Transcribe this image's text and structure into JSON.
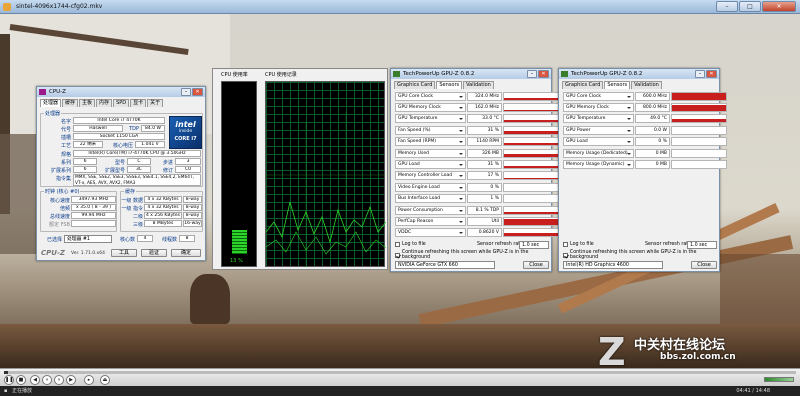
{
  "player": {
    "title": "sintel-4096x1744-cfg02.mkv",
    "status_text": "正在播放",
    "time": "04:41 / 14:48"
  },
  "watermark": {
    "cn": "中关村在线论坛",
    "url": "bbs.zol.com.cn"
  },
  "cpuz": {
    "title": "CPU-Z",
    "tabs": [
      "处理器",
      "缓存",
      "主板",
      "内存",
      "SPD",
      "显卡",
      "关于"
    ],
    "group_processor": "处理器",
    "name_label": "名字",
    "name": "Intel Core i7 4770K",
    "codename_label": "代号",
    "codename": "Haswell",
    "tdp_label": "TDP",
    "tdp": "84.0 W",
    "package_label": "插槽",
    "package": "Socket 1150 LGA",
    "tech_label": "工艺",
    "tech": "22 纳米",
    "voltage_label": "核心电压",
    "voltage": "1.041 V",
    "spec_label": "规格",
    "spec": "Intel(R) Core(TM) i7-4770K CPU @ 3.50GHz",
    "family_label": "系列",
    "family": "6",
    "model_label": "型号",
    "model": "C",
    "stepping_label": "步进",
    "stepping": "3",
    "extfamily_label": "扩展系列",
    "extfamily": "6",
    "extmodel_label": "扩展型号",
    "extmodel": "3C",
    "revision_label": "修订",
    "revision": "C0",
    "instr_label": "指令集",
    "instr": "MMX, SSE, SSE2, SSE3, SSSE3, SSE4.1, SSE4.2, EM64T, VT-x, AES, AVX, AVX2, FMA3",
    "clocks_group": "时钟 (核心 #0)",
    "core_speed_label": "核心速度",
    "core_speed": "3497.93 MHz",
    "multiplier_label": "倍频",
    "multiplier": "x 35.0 ( 8 - 39 )",
    "bus_label": "总线速度",
    "bus": "99.94 MHz",
    "fsb_label": "额定 FSB",
    "fsb": "",
    "cache_group": "缓存",
    "l1d_label": "一级 数据",
    "l1d": "4 x 32 KBytes",
    "l1d_way": "8-way",
    "l1i_label": "一级 指令",
    "l1i": "4 x 32 KBytes",
    "l1i_way": "8-way",
    "l2_label": "二级",
    "l2": "4 x 256 KBytes",
    "l2_way": "8-way",
    "l3_label": "三级",
    "l3": "8 MBytes",
    "l3_way": "16-way",
    "selected_label": "已选择",
    "selected": "处理器 #1",
    "cores_label": "核心数",
    "cores": "4",
    "threads_label": "线程数",
    "threads": "8",
    "version": "Ver. 1.71.0.x64",
    "tools_btn": "工具",
    "validate_btn": "验证",
    "ok_btn": "确定",
    "logo_brand": "intel",
    "logo_line1": "inside",
    "logo_line2": "CORE i7"
  },
  "taskmgr": {
    "cpu_usage_label": "CPU 使用率",
    "cpu_history_label": "CPU 使用记录",
    "usage_percent": "13 %",
    "usage_value": 0.13
  },
  "gpuz1": {
    "title": "TechPowerUp GPU-Z 0.8.2",
    "tabs": [
      "Graphics Card",
      "Sensors",
      "Validation"
    ],
    "sensors": [
      {
        "name": "GPU Core Clock",
        "value": "324.0 MHz",
        "level": 0.25
      },
      {
        "name": "GPU Memory Clock",
        "value": "162.0 MHz",
        "level": 0.15
      },
      {
        "name": "GPU Temperature",
        "value": "33.0 °C",
        "level": 0.35
      },
      {
        "name": "Fan Speed (%)",
        "value": "31 %",
        "level": 0.35
      },
      {
        "name": "Fan Speed (RPM)",
        "value": "1140 RPM",
        "level": 0.35
      },
      {
        "name": "Memory Used",
        "value": "326 MB",
        "level": 0.4
      },
      {
        "name": "GPU Load",
        "value": "31 %",
        "level": 0.3
      },
      {
        "name": "Memory Controller Load",
        "value": "17 %",
        "level": 0.2
      },
      {
        "name": "Video Engine Load",
        "value": "0 %",
        "level": 0.0
      },
      {
        "name": "Bus Interface Load",
        "value": "1 %",
        "level": 0.05
      },
      {
        "name": "Power Consumption",
        "value": "8.1 % TDP",
        "level": 0.2
      },
      {
        "name": "PerfCap Reason",
        "value": "Util",
        "level": 0.9
      },
      {
        "name": "VDDC",
        "value": "0.8620 V",
        "level": 0.45
      }
    ],
    "log_to_file": "Log to file",
    "continue_refresh": "Continue refreshing this screen while GPU-Z is in the background",
    "refresh_rate_label": "Sensor refresh rate:",
    "refresh_rate": "1.0 sec",
    "device": "NVIDIA GeForce GTX 660",
    "close_btn": "Close"
  },
  "gpuz2": {
    "title": "TechPowerUp GPU-Z 0.8.2",
    "tabs": [
      "Graphics Card",
      "Sensors",
      "Validation"
    ],
    "sensors": [
      {
        "name": "GPU Core Clock",
        "value": "600.0 MHz",
        "level": 0.9
      },
      {
        "name": "GPU Memory Clock",
        "value": "800.0 MHz",
        "level": 0.9
      },
      {
        "name": "GPU Temperature",
        "value": "49.0 °C",
        "level": 0.5
      },
      {
        "name": "GPU Power",
        "value": "0.0 W",
        "level": 0.0
      },
      {
        "name": "GPU Load",
        "value": "0 %",
        "level": 0.0
      },
      {
        "name": "Memory Usage (Dedicated)",
        "value": "0 MB",
        "level": 0.0
      },
      {
        "name": "Memory Usage (Dynamic)",
        "value": "0 MB",
        "level": 0.0
      }
    ],
    "log_to_file": "Log to file",
    "continue_refresh": "Continue refreshing this screen while GPU-Z is in the background",
    "refresh_rate_label": "Sensor refresh rate:",
    "refresh_rate": "1.0 sec",
    "device": "Intel(R) HD Graphics 4600",
    "close_btn": "Close"
  }
}
